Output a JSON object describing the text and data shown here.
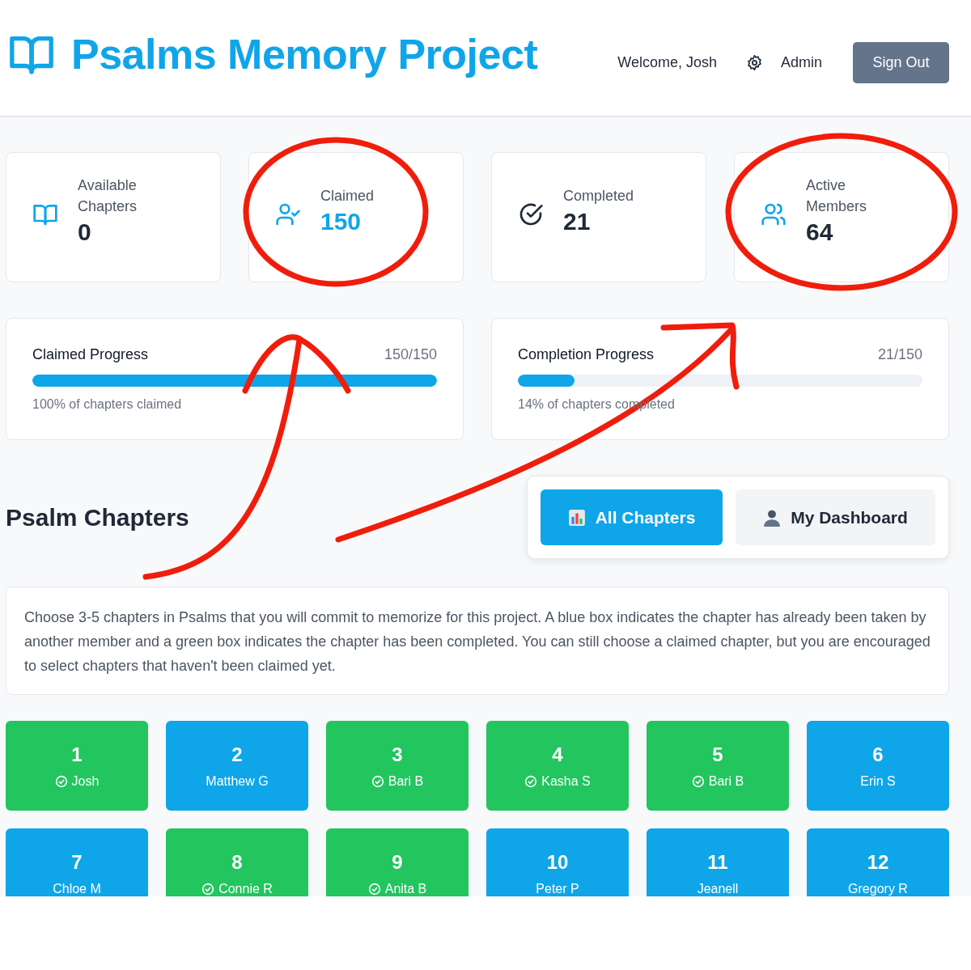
{
  "header": {
    "title": "Psalms Memory Project",
    "welcome": "Welcome, Josh",
    "admin_link": "Admin",
    "sign_out": "Sign Out"
  },
  "stats": [
    {
      "kind": "book",
      "label": "Available Chapters",
      "value": "0",
      "highlight": false
    },
    {
      "kind": "claimed",
      "label": "Claimed",
      "value": "150",
      "highlight": true
    },
    {
      "kind": "completed",
      "label": "Completed",
      "value": "21",
      "highlight": false
    },
    {
      "kind": "members",
      "label": "Active Members",
      "value": "64",
      "highlight": false
    }
  ],
  "progress": [
    {
      "title": "Claimed Progress",
      "count": "150/150",
      "level": 1.0,
      "caption": "100% of chapters claimed"
    },
    {
      "title": "Completion Progress",
      "count": "21/150",
      "level": 0.14,
      "caption": "14% of chapters completed"
    }
  ],
  "section_title": "Psalm Chapters",
  "view_tabs": [
    {
      "kind": "chart",
      "label": "All Chapters",
      "selected": true
    },
    {
      "kind": "person",
      "label": "My Dashboard",
      "selected": false
    }
  ],
  "description": "Choose 3-5 chapters in Psalms that you will commit to memorize for this project. A blue box indicates the chapter has already been taken by another member and a green box indicates the chapter has been completed. You can still choose a claimed chapter, but you are encouraged to select chapters that haven't been claimed yet.",
  "chapters": [
    {
      "number": "1",
      "member": "Josh",
      "completed": true
    },
    {
      "number": "2",
      "member": "Matthew G",
      "completed": false
    },
    {
      "number": "3",
      "member": "Bari B",
      "completed": true
    },
    {
      "number": "4",
      "member": "Kasha S",
      "completed": true
    },
    {
      "number": "5",
      "member": "Bari B",
      "completed": true
    },
    {
      "number": "6",
      "member": "Erin S",
      "completed": false
    },
    {
      "number": "7",
      "member": "Chloe M",
      "completed": false
    },
    {
      "number": "8",
      "member": "Connie R",
      "completed": true
    },
    {
      "number": "9",
      "member": "Anita B",
      "completed": true
    },
    {
      "number": "10",
      "member": "Peter P",
      "completed": false
    },
    {
      "number": "11",
      "member": "Jeanell",
      "completed": false
    },
    {
      "number": "12",
      "member": "Gregory R",
      "completed": false
    }
  ]
}
